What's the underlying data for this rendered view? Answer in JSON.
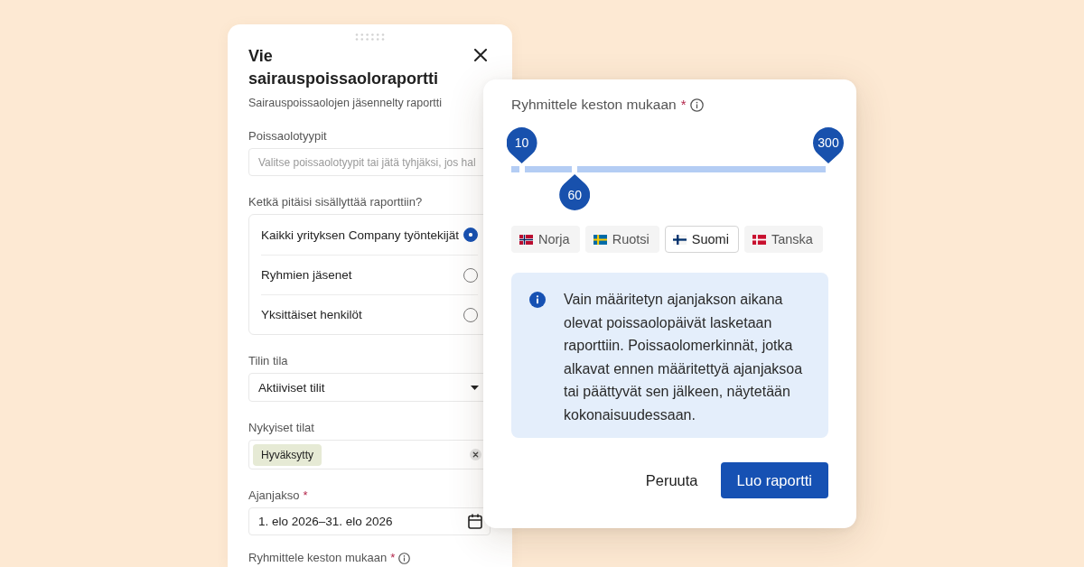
{
  "form_panel": {
    "title": "Vie sairauspoissaoloraportti",
    "subtitle": "Sairauspoissaolojen jäsennelty raportti",
    "absence_types": {
      "label": "Poissaolotyypit",
      "placeholder": "Valitse poissaolotyypit tai jätä tyhjäksi, jos hal"
    },
    "recipients": {
      "label": "Ketkä pitäisi sisällyttää raporttiin?",
      "options": [
        {
          "label": "Kaikki yrityksen Company työntekijät",
          "selected": true
        },
        {
          "label": "Ryhmien jäsenet",
          "selected": false
        },
        {
          "label": "Yksittäiset henkilöt",
          "selected": false
        }
      ]
    },
    "account_status": {
      "label": "Tilin tila",
      "value": "Aktiiviset tilit"
    },
    "current_statuses": {
      "label": "Nykyiset tilat",
      "chips": [
        "Hyväksytty"
      ]
    },
    "period": {
      "label": "Ajanjakso",
      "required_mark": "*",
      "value": "1. elo 2026–31. elo 2026"
    },
    "duration_grouping": {
      "label": "Ryhmittele keston mukaan",
      "required_mark": "*"
    }
  },
  "duration_dialog": {
    "label": "Ryhmittele keston mukaan",
    "required_mark": "*",
    "handles": [
      {
        "value": "10",
        "level": 0.033,
        "kind": "above"
      },
      {
        "value": "60",
        "level": 0.2,
        "kind": "below"
      },
      {
        "value": "300",
        "level": 1,
        "kind": "above"
      }
    ],
    "countries": [
      {
        "label": "Norja",
        "kind": "norway",
        "selected": false
      },
      {
        "label": "Ruotsi",
        "kind": "sweden",
        "selected": false
      },
      {
        "label": "Suomi",
        "kind": "finland",
        "selected": true
      },
      {
        "label": "Tanska",
        "kind": "denmark",
        "selected": false
      }
    ],
    "notice": "Vain määritetyn ajanjakson aikana olevat poissaolopäivät lasketaan raporttiin. Poissaolomerkinnät, jotka alkavat ennen määritettyä ajanjaksoa tai päättyvät sen jälkeen, näytetään kokonaisuudessaan.",
    "buttons": [
      {
        "label": "Peruuta",
        "kind": "secondary"
      },
      {
        "label": "Luo raportti",
        "kind": "primary"
      }
    ]
  }
}
